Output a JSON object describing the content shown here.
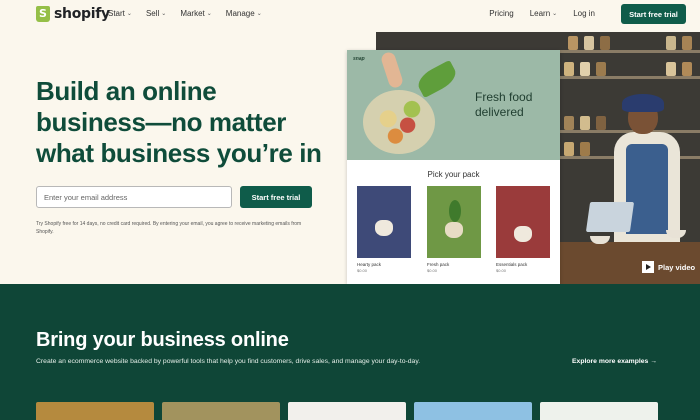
{
  "nav": {
    "logo_text": "shopify",
    "menu": [
      {
        "label": "Start"
      },
      {
        "label": "Sell"
      },
      {
        "label": "Market"
      },
      {
        "label": "Manage"
      }
    ],
    "pricing_label": "Pricing",
    "learn_label": "Learn",
    "login_label": "Log in",
    "cta_label": "Start free trial"
  },
  "hero": {
    "title_lines": [
      "Build an online",
      "business—no matter",
      "what business you’re in"
    ],
    "email_placeholder": "Enter your email address",
    "cta_label": "Start free trial",
    "disclaimer": "Try Shopify free for 14 days, no credit card required. By entering your email, you agree to receive marketing emails from Shopify."
  },
  "media": {
    "play_label": "Play video",
    "store_mockup": {
      "logo": "snap",
      "banner_lines": [
        "Fresh food",
        "delivered"
      ],
      "section_title": "Pick your pack",
      "packs": [
        {
          "name": "Hearty pack",
          "price": "$0.00"
        },
        {
          "name": "Fresh pack",
          "price": "$0.00"
        },
        {
          "name": "Essentials pack",
          "price": "$0.00"
        }
      ]
    }
  },
  "section2": {
    "title": "Bring your business online",
    "subtitle": "Create an ecommerce website backed by powerful tools that help you find customers, drive sales, and manage your day-to-day.",
    "explore_label": "Explore more examples",
    "explore_arrow": "→"
  },
  "colors": {
    "brand_green": "#0f5c4a",
    "dark_section": "#0f4637",
    "hero_bg": "#fbf7ed",
    "logo_green": "#95bf47"
  }
}
